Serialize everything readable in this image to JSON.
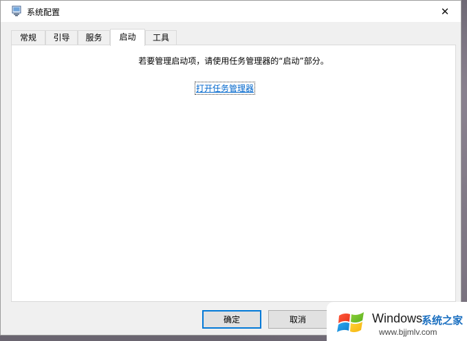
{
  "window": {
    "title": "系统配置",
    "close_glyph": "✕"
  },
  "tabs": [
    {
      "label": "常规",
      "active": false
    },
    {
      "label": "引导",
      "active": false
    },
    {
      "label": "服务",
      "active": false
    },
    {
      "label": "启动",
      "active": true
    },
    {
      "label": "工具",
      "active": false
    }
  ],
  "startup_panel": {
    "instruction": "若要管理启动项，请使用任务管理器的“启动”部分。",
    "link_label": "打开任务管理器"
  },
  "buttons": {
    "ok_label": "确定",
    "cancel_label": "取消"
  },
  "watermark": {
    "brand": "Windows",
    "site_name": "系统之家",
    "url": "www.bjjmlv.com"
  },
  "colors": {
    "link": "#0066cc",
    "default_button_border": "#0078d7",
    "watermark_site": "#1a6fc0"
  },
  "icons": {
    "app": "msconfig-icon",
    "close": "close-icon",
    "logo": "windows-logo-icon"
  }
}
